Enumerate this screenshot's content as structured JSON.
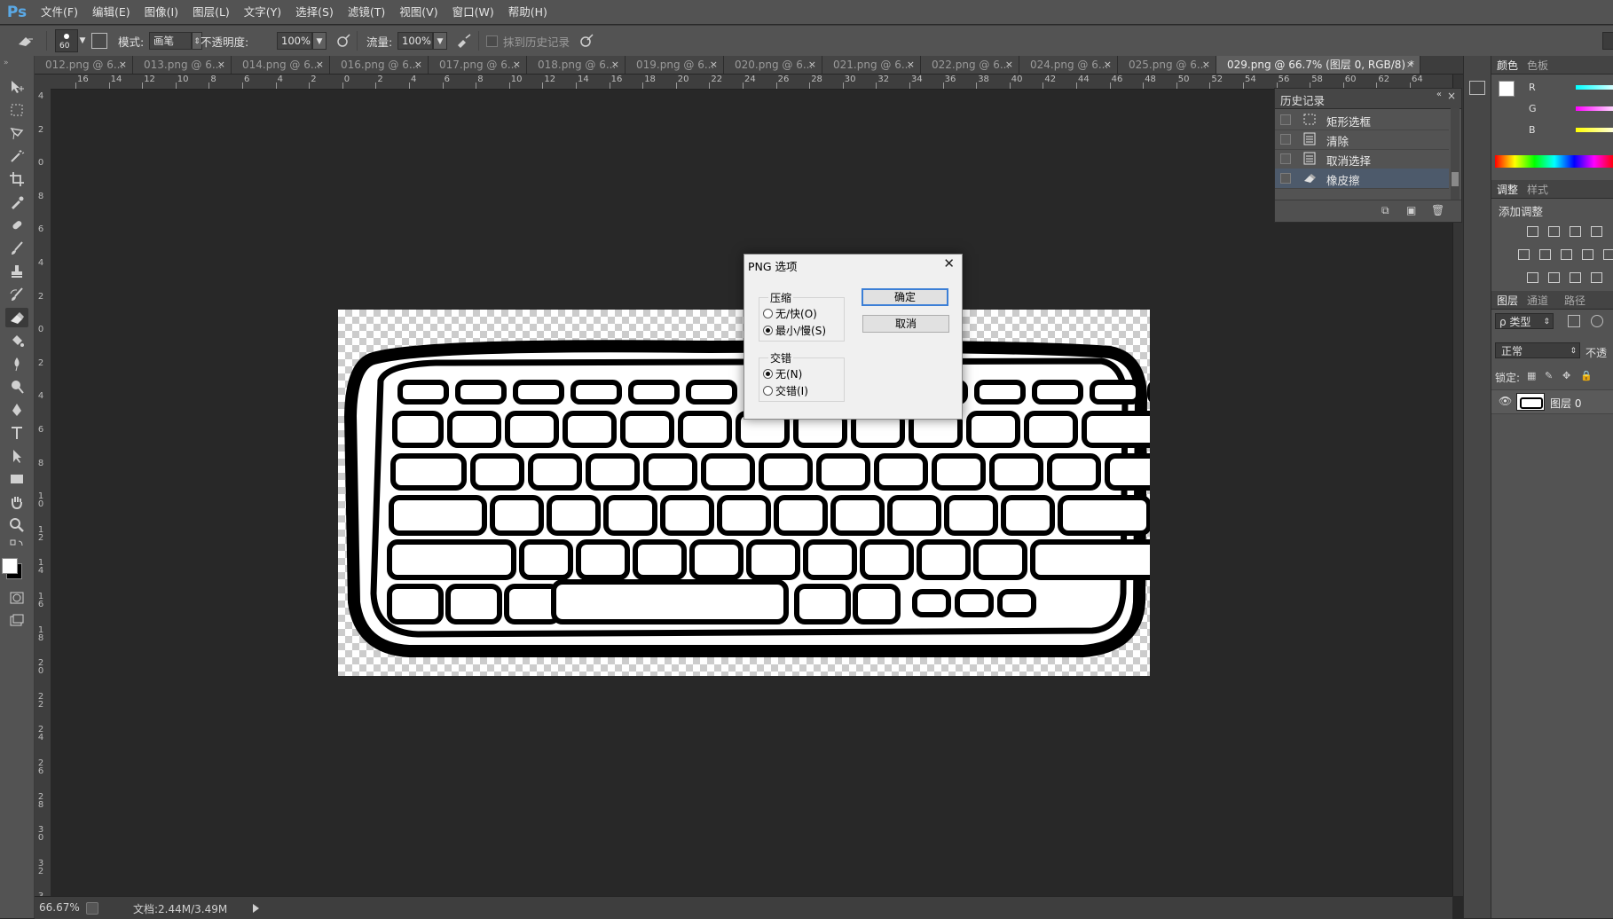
{
  "app": {
    "logo": "Ps"
  },
  "menu": [
    "文件(F)",
    "编辑(E)",
    "图像(I)",
    "图层(L)",
    "文字(Y)",
    "选择(S)",
    "滤镜(T)",
    "视图(V)",
    "窗口(W)",
    "帮助(H)"
  ],
  "options": {
    "brush_size": "60",
    "mode_label": "模式:",
    "mode_value": "画笔",
    "opacity_label": "不透明度:",
    "opacity_value": "100%",
    "flow_label": "流量:",
    "flow_value": "100%",
    "erase_history_label": "抹到历史记录"
  },
  "tabs": [
    {
      "label": "012.png @ 6...",
      "active": false
    },
    {
      "label": "013.png @ 6...",
      "active": false
    },
    {
      "label": "014.png @ 6...",
      "active": false
    },
    {
      "label": "016.png @ 6...",
      "active": false
    },
    {
      "label": "017.png @ 6...",
      "active": false
    },
    {
      "label": "018.png @ 6...",
      "active": false
    },
    {
      "label": "019.png @ 6...",
      "active": false
    },
    {
      "label": "020.png @ 6...",
      "active": false
    },
    {
      "label": "021.png @ 6...",
      "active": false
    },
    {
      "label": "022.png @ 6...",
      "active": false
    },
    {
      "label": "024.png @ 6...",
      "active": false
    },
    {
      "label": "025.png @ 6...",
      "active": false
    },
    {
      "label": "029.png @ 66.7% (图层 0, RGB/8) *",
      "active": true
    }
  ],
  "ruler_h_labels": [
    "16",
    "14",
    "12",
    "10",
    "8",
    "6",
    "4",
    "2",
    "0",
    "2",
    "4",
    "6",
    "8",
    "10",
    "12",
    "14",
    "16",
    "18",
    "20",
    "22",
    "24",
    "26",
    "28",
    "30",
    "32",
    "34",
    "36",
    "38",
    "40",
    "42",
    "44",
    "46",
    "48",
    "50",
    "52",
    "54",
    "56",
    "58",
    "60",
    "62",
    "64"
  ],
  "ruler_v_labels": [
    "4",
    "2",
    "0",
    "8",
    "6",
    "4",
    "2",
    "0",
    "2",
    "4",
    "6",
    "8",
    "10",
    "12",
    "14",
    "16",
    "18",
    "20",
    "22",
    "24",
    "26",
    "28",
    "30",
    "32",
    "34"
  ],
  "status": {
    "zoom": "66.67%",
    "doc": "文档:2.44M/3.49M"
  },
  "history": {
    "title": "历史记录",
    "items": [
      {
        "label": "矩形选框",
        "icon": "rect-marquee-icon",
        "selected": false
      },
      {
        "label": "清除",
        "icon": "document-icon",
        "selected": false
      },
      {
        "label": "取消选择",
        "icon": "document-icon",
        "selected": false
      },
      {
        "label": "橡皮擦",
        "icon": "eraser-icon",
        "selected": true
      }
    ]
  },
  "color_panel": {
    "tab1": "颜色",
    "tab2": "色板",
    "r": "R",
    "g": "G",
    "b": "B"
  },
  "adjust_panel": {
    "tab1": "调整",
    "tab2": "样式",
    "add_label": "添加调整"
  },
  "layers_panel": {
    "tab1": "图层",
    "tab2": "通道",
    "tab3": "路径",
    "filter_label": "ρ 类型",
    "blend_mode": "正常",
    "opacity_short": "不透",
    "lock_label": "锁定:",
    "layer_name": "图层 0"
  },
  "dialog": {
    "title": "PNG 选项",
    "compression_title": "压缩",
    "compression_none": "无/快(O)",
    "compression_small": "最小/慢(S)",
    "compression_selected": "small",
    "interlace_title": "交错",
    "interlace_none": "无(N)",
    "interlace_on": "交错(I)",
    "interlace_selected": "none",
    "ok": "确定",
    "cancel": "取消"
  }
}
